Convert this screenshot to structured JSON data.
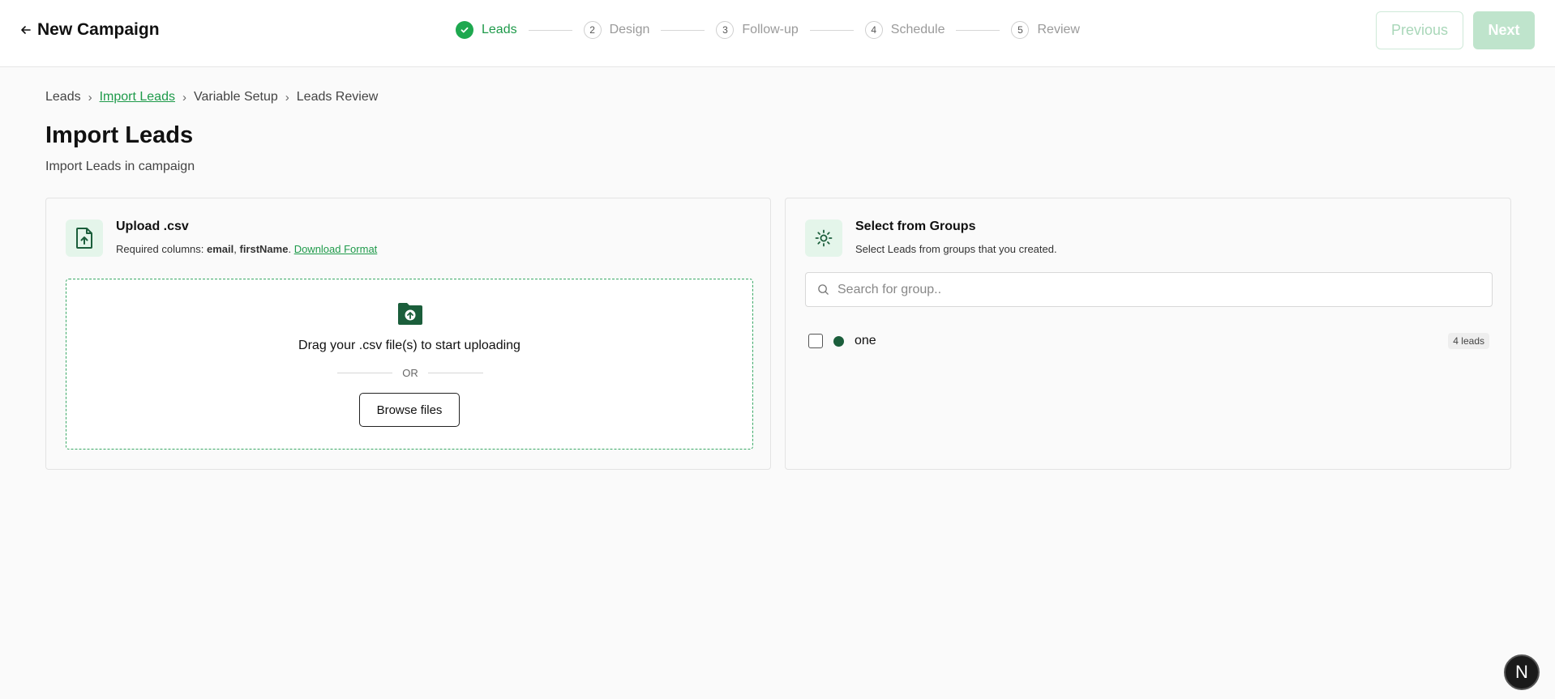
{
  "header": {
    "title": "New Campaign",
    "previous_label": "Previous",
    "next_label": "Next"
  },
  "stepper": {
    "steps": [
      {
        "number": "1",
        "label": "Leads",
        "status": "completed"
      },
      {
        "number": "2",
        "label": "Design",
        "status": "pending"
      },
      {
        "number": "3",
        "label": "Follow-up",
        "status": "pending"
      },
      {
        "number": "4",
        "label": "Schedule",
        "status": "pending"
      },
      {
        "number": "5",
        "label": "Review",
        "status": "pending"
      }
    ]
  },
  "breadcrumb": {
    "items": [
      "Leads",
      "Import Leads",
      "Variable Setup",
      "Leads Review"
    ],
    "separator": "›",
    "current_index": 1
  },
  "page": {
    "title": "Import Leads",
    "subtitle": "Import Leads in campaign"
  },
  "upload": {
    "title": "Upload .csv",
    "desc_prefix": "Required columns: ",
    "col1": "email",
    "comma": ", ",
    "col2": "firstName",
    "dot": ". ",
    "download_link": "Download Format",
    "drop_text": "Drag your .csv file(s) to start uploading",
    "or_text": "OR",
    "browse_label": "Browse files"
  },
  "groups": {
    "title": "Select from Groups",
    "description": "Select Leads from groups that you created.",
    "search_placeholder": "Search for group..",
    "search_value": "",
    "items": [
      {
        "name": "one",
        "count": "4 leads",
        "color": "#1b5e3b",
        "checked": false
      }
    ]
  },
  "fab": {
    "label": "N"
  },
  "colors": {
    "accent": "#1e9a4a",
    "accent_light": "#e4f5ea",
    "next_disabled": "#bfe4cc"
  }
}
